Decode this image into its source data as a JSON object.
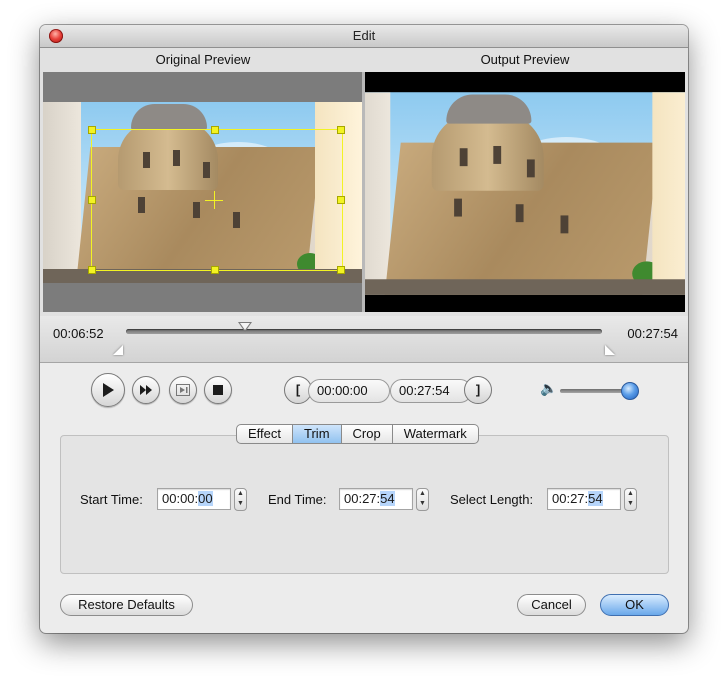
{
  "window": {
    "title": "Edit"
  },
  "preview": {
    "original_label": "Original Preview",
    "output_label": "Output Preview"
  },
  "timeline": {
    "current_time": "00:06:52",
    "total_time": "00:27:54"
  },
  "playback": {
    "play_icon": "play-icon",
    "fast_forward_icon": "fast-forward-icon",
    "step_icon": "step-frame-icon",
    "stop_icon": "stop-icon",
    "start_bracket": "[",
    "start_value": "00:00:00",
    "end_value": "00:27:54",
    "end_bracket": "]",
    "volume_level": 0.88
  },
  "tabs": [
    {
      "label": "Effect",
      "selected": false
    },
    {
      "label": "Trim",
      "selected": true
    },
    {
      "label": "Crop",
      "selected": false
    },
    {
      "label": "Watermark",
      "selected": false
    }
  ],
  "trim": {
    "start_time_label": "Start Time:",
    "start_time_prefix": "00:00:",
    "start_time_selected": "00",
    "end_time_label": "End Time:",
    "end_time_prefix": "00:27:",
    "end_time_selected": "54",
    "select_length_label": "Select Length:",
    "select_length_prefix": "00:27:",
    "select_length_selected": "54"
  },
  "buttons": {
    "restore_defaults": "Restore Defaults",
    "cancel": "Cancel",
    "ok": "OK"
  },
  "colors": {
    "accent": "#6aa8ea",
    "crop_frame": "#f3f323",
    "selected_tab": "#91c2f0"
  }
}
